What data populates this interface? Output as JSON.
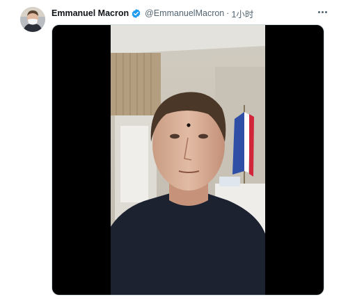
{
  "tweet": {
    "author": {
      "display_name": "Emmanuel Macron",
      "handle": "@EmmanuelMacron",
      "verified": true
    },
    "separator": "·",
    "timestamp": "1小时",
    "more_icon": "more-horizontal-icon",
    "media": {
      "kind": "video",
      "description_icon": "video-frame"
    }
  },
  "colors": {
    "name": "#0f1419",
    "secondary": "#536471",
    "verified": "#1d9bf0",
    "media_bg": "#000000"
  }
}
